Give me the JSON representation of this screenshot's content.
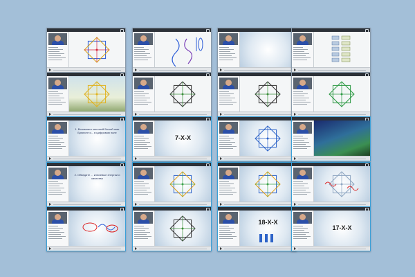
{
  "thumbnails": [
    {
      "row": 1,
      "col": 1,
      "style": "white",
      "slide_text": "",
      "big_label": "",
      "figure": "star-color"
    },
    {
      "row": 1,
      "col": 2,
      "style": "white",
      "slide_text": "",
      "big_label": "",
      "figure": "handwriting"
    },
    {
      "row": 1,
      "col": 3,
      "style": "blue",
      "slide_text": "",
      "big_label": "",
      "title_small": "",
      "figure": "none"
    },
    {
      "row": 1,
      "col": 4,
      "style": "white",
      "slide_text": "",
      "big_label": "",
      "figure": "ladder"
    },
    {
      "row": 2,
      "col": 1,
      "style": "tree",
      "slide_text": "",
      "big_label": "",
      "figure": "star-gold"
    },
    {
      "row": 2,
      "col": 2,
      "style": "white",
      "slide_text": "",
      "big_label": "",
      "figure": "star-simple"
    },
    {
      "row": 2,
      "col": 3,
      "style": "white",
      "slide_text": "",
      "big_label": "",
      "figure": "star-simple"
    },
    {
      "row": 2,
      "col": 4,
      "style": "white",
      "slide_text": "",
      "big_label": "",
      "figure": "star-green"
    },
    {
      "row": 3,
      "col": 1,
      "style": "blue",
      "slide_text": "1. Вспомните местный Белый свет Брюнсте и... в цифровом поле",
      "big_label": "",
      "figure": "none"
    },
    {
      "row": 3,
      "col": 2,
      "style": "blue",
      "slide_text": "",
      "big_label": "7-X-X",
      "figure": "none"
    },
    {
      "row": 3,
      "col": 3,
      "style": "blue",
      "slide_text": "",
      "big_label": "",
      "figure": "star-blue"
    },
    {
      "row": 3,
      "col": 4,
      "style": "painting",
      "slide_text": "",
      "big_label": "",
      "figure": "none"
    },
    {
      "row": 4,
      "col": 1,
      "style": "blue",
      "slide_text": "2. Обведите ... ключевые энергии и качества",
      "big_label": "",
      "figure": "none"
    },
    {
      "row": 4,
      "col": 2,
      "style": "blue",
      "slide_text": "",
      "big_label": "",
      "figure": "star-colored"
    },
    {
      "row": 4,
      "col": 3,
      "style": "blue",
      "slide_text": "",
      "big_label": "",
      "figure": "star-colored"
    },
    {
      "row": 4,
      "col": 4,
      "style": "blue",
      "slide_text": "",
      "big_label": "",
      "figure": "star-redmarks"
    },
    {
      "row": 5,
      "col": 1,
      "style": "blue",
      "slide_text": "",
      "big_label": "",
      "figure": "red-scribble"
    },
    {
      "row": 5,
      "col": 2,
      "style": "blue",
      "slide_text": "",
      "big_label": "",
      "figure": "star-simple"
    },
    {
      "row": 5,
      "col": 3,
      "style": "blue",
      "slide_text": "",
      "big_label": "18-X-X",
      "figure": "bars"
    },
    {
      "row": 5,
      "col": 4,
      "style": "blue",
      "slide_text": "",
      "big_label": "17-X-X",
      "figure": "none"
    }
  ]
}
